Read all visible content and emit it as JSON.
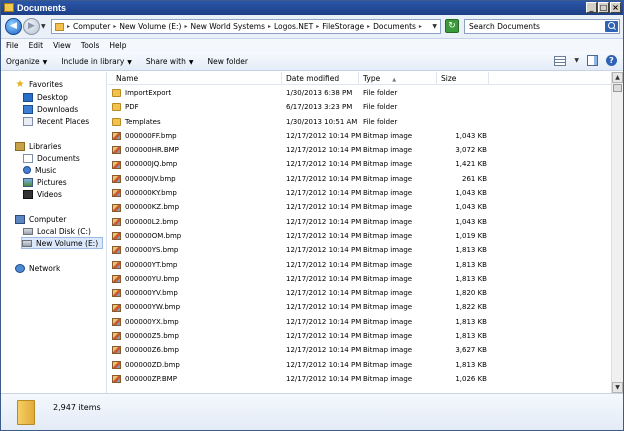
{
  "window": {
    "title": "Documents"
  },
  "titlebar_buttons": [
    "_",
    "□",
    "×"
  ],
  "address": {
    "crumbs": [
      "Computer",
      "New Volume (E:)",
      "New World Systems",
      "Logos.NET",
      "FileStorage",
      "Documents"
    ],
    "search_placeholder": "Search Documents"
  },
  "menu": [
    "File",
    "Edit",
    "View",
    "Tools",
    "Help"
  ],
  "toolbar": {
    "organize": "Organize",
    "include_library": "Include in library",
    "share_with": "Share with",
    "new_folder": "New folder"
  },
  "nav": {
    "favorites": "Favorites",
    "desktop": "Desktop",
    "downloads": "Downloads",
    "recent": "Recent Places",
    "libraries": "Libraries",
    "documents": "Documents",
    "music": "Music",
    "pictures": "Pictures",
    "videos": "Videos",
    "computer": "Computer",
    "local_disk": "Local Disk (C:)",
    "new_volume": "New Volume (E:)",
    "network": "Network"
  },
  "columns": {
    "name": "Name",
    "date": "Date modified",
    "type": "Type",
    "size": "Size"
  },
  "files": [
    {
      "name": "ImportExport",
      "date": "1/30/2013 6:38 PM",
      "type": "File folder",
      "size": "",
      "kind": "folder"
    },
    {
      "name": "PDF",
      "date": "6/17/2013 3:23 PM",
      "type": "File folder",
      "size": "",
      "kind": "folder"
    },
    {
      "name": "Templates",
      "date": "1/30/2013 10:51 AM",
      "type": "File folder",
      "size": "",
      "kind": "folder"
    },
    {
      "name": "000000FF.bmp",
      "date": "12/17/2012 10:14 PM",
      "type": "Bitmap image",
      "size": "1,043 KB",
      "kind": "bitmap"
    },
    {
      "name": "000000HR.BMP",
      "date": "12/17/2012 10:14 PM",
      "type": "Bitmap image",
      "size": "3,072 KB",
      "kind": "bitmap"
    },
    {
      "name": "000000JQ.bmp",
      "date": "12/17/2012 10:14 PM",
      "type": "Bitmap image",
      "size": "1,421 KB",
      "kind": "bitmap"
    },
    {
      "name": "000000JV.bmp",
      "date": "12/17/2012 10:14 PM",
      "type": "Bitmap image",
      "size": "261 KB",
      "kind": "bitmap"
    },
    {
      "name": "000000KY.bmp",
      "date": "12/17/2012 10:14 PM",
      "type": "Bitmap image",
      "size": "1,043 KB",
      "kind": "bitmap"
    },
    {
      "name": "000000KZ.bmp",
      "date": "12/17/2012 10:14 PM",
      "type": "Bitmap image",
      "size": "1,043 KB",
      "kind": "bitmap"
    },
    {
      "name": "000000L2.bmp",
      "date": "12/17/2012 10:14 PM",
      "type": "Bitmap image",
      "size": "1,043 KB",
      "kind": "bitmap"
    },
    {
      "name": "000000OM.bmp",
      "date": "12/17/2012 10:14 PM",
      "type": "Bitmap image",
      "size": "1,019 KB",
      "kind": "bitmap"
    },
    {
      "name": "000000YS.bmp",
      "date": "12/17/2012 10:14 PM",
      "type": "Bitmap image",
      "size": "1,813 KB",
      "kind": "bitmap"
    },
    {
      "name": "000000YT.bmp",
      "date": "12/17/2012 10:14 PM",
      "type": "Bitmap image",
      "size": "1,813 KB",
      "kind": "bitmap"
    },
    {
      "name": "000000YU.bmp",
      "date": "12/17/2012 10:14 PM",
      "type": "Bitmap image",
      "size": "1,813 KB",
      "kind": "bitmap"
    },
    {
      "name": "000000YV.bmp",
      "date": "12/17/2012 10:14 PM",
      "type": "Bitmap image",
      "size": "1,820 KB",
      "kind": "bitmap"
    },
    {
      "name": "000000YW.bmp",
      "date": "12/17/2012 10:14 PM",
      "type": "Bitmap image",
      "size": "1,822 KB",
      "kind": "bitmap"
    },
    {
      "name": "000000YX.bmp",
      "date": "12/17/2012 10:14 PM",
      "type": "Bitmap image",
      "size": "1,813 KB",
      "kind": "bitmap"
    },
    {
      "name": "000000Z5.bmp",
      "date": "12/17/2012 10:14 PM",
      "type": "Bitmap image",
      "size": "1,813 KB",
      "kind": "bitmap"
    },
    {
      "name": "000000Z6.bmp",
      "date": "12/17/2012 10:14 PM",
      "type": "Bitmap image",
      "size": "3,627 KB",
      "kind": "bitmap"
    },
    {
      "name": "000000ZD.bmp",
      "date": "12/17/2012 10:14 PM",
      "type": "Bitmap image",
      "size": "1,813 KB",
      "kind": "bitmap"
    },
    {
      "name": "000000ZP.BMP",
      "date": "12/17/2012 10:14 PM",
      "type": "Bitmap image",
      "size": "1,026 KB",
      "kind": "bitmap"
    }
  ],
  "status": {
    "item_count": "2,947 items"
  }
}
